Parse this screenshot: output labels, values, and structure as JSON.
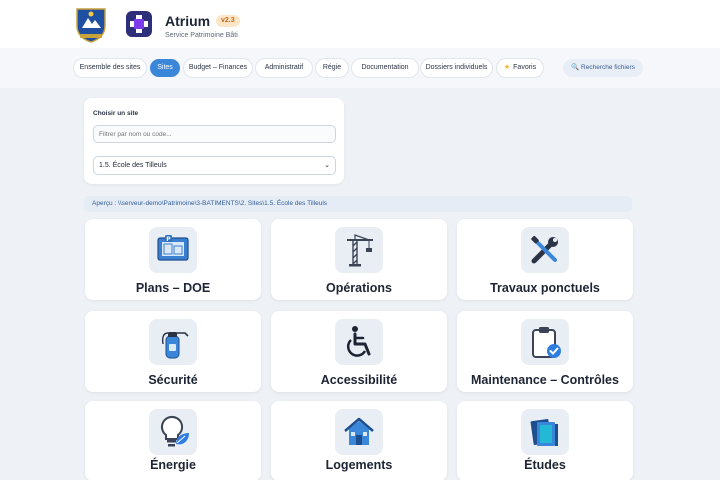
{
  "header": {
    "title": "Atrium",
    "version": "v2.3",
    "subtitle": "Service Patrimoine Bâti"
  },
  "nav": {
    "tabs": [
      {
        "label": "Ensemble des sites",
        "active": false
      },
      {
        "label": "Sites",
        "active": true
      },
      {
        "label": "Budget – Finances",
        "active": false
      },
      {
        "label": "Administratif",
        "active": false
      },
      {
        "label": "Régie",
        "active": false
      },
      {
        "label": "Documentation",
        "active": false
      },
      {
        "label": "Dossiers individuels",
        "active": false
      },
      {
        "label": "Favoris",
        "active": false
      }
    ],
    "search_label": "🔍 Recherche fichiers"
  },
  "site_picker": {
    "label": "Choisir un site",
    "filter_placeholder": "Filtrer par nom ou code...",
    "selected_site": "1.5. École des Tilleuls"
  },
  "path_preview": "Aperçu : \\\\serveur-demo\\Patrimoine\\3-BATIMENTS\\2. Sites\\1.5. École des Tilleuls",
  "tiles": [
    {
      "label": "Plans – DOE",
      "icon": "blueprint-icon"
    },
    {
      "label": "Opérations",
      "icon": "crane-icon"
    },
    {
      "label": "Travaux ponctuels",
      "icon": "tools-icon"
    },
    {
      "label": "Sécurité",
      "icon": "fire-extinguisher-icon"
    },
    {
      "label": "Accessibilité",
      "icon": "wheelchair-icon"
    },
    {
      "label": "Maintenance – Contrôles",
      "icon": "clipboard-check-icon"
    },
    {
      "label": "Énergie",
      "icon": "lightbulb-leaf-icon"
    },
    {
      "label": "Logements",
      "icon": "house-icon"
    },
    {
      "label": "Études",
      "icon": "books-icon"
    }
  ],
  "colors": {
    "accent": "#3a86d9",
    "version_badge": "#fde6c8",
    "background": "#eef1f6"
  }
}
